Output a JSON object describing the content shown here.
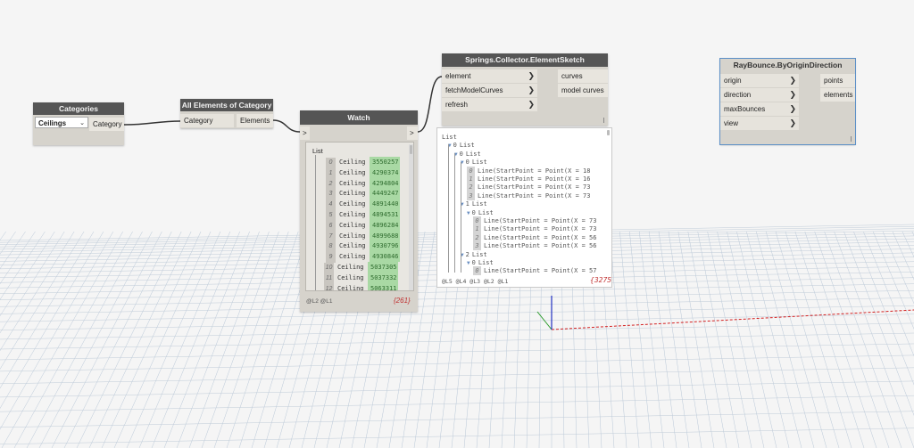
{
  "nodes": {
    "categories": {
      "title": "Categories",
      "dropdown_value": "Ceilings",
      "output": "Category"
    },
    "all_elements": {
      "title": "All Elements of Category",
      "input": "Category",
      "output": "Elements"
    },
    "watch": {
      "title": "Watch",
      "root_label": "List",
      "rows": [
        {
          "idx": "0",
          "cat": "Ceiling",
          "id": "3550257"
        },
        {
          "idx": "1",
          "cat": "Ceiling",
          "id": "4290374"
        },
        {
          "idx": "2",
          "cat": "Ceiling",
          "id": "4294804"
        },
        {
          "idx": "3",
          "cat": "Ceiling",
          "id": "4449247"
        },
        {
          "idx": "4",
          "cat": "Ceiling",
          "id": "4891440"
        },
        {
          "idx": "5",
          "cat": "Ceiling",
          "id": "4894531"
        },
        {
          "idx": "6",
          "cat": "Ceiling",
          "id": "4896284"
        },
        {
          "idx": "7",
          "cat": "Ceiling",
          "id": "4899688"
        },
        {
          "idx": "8",
          "cat": "Ceiling",
          "id": "4930796"
        },
        {
          "idx": "9",
          "cat": "Ceiling",
          "id": "4930846"
        },
        {
          "idx": "10",
          "cat": "Ceiling",
          "id": "5037305"
        },
        {
          "idx": "11",
          "cat": "Ceiling",
          "id": "5037332"
        },
        {
          "idx": "12",
          "cat": "Ceiling",
          "id": "5063311"
        }
      ],
      "levels": "@L2 @L1",
      "count": "{261}"
    },
    "element_sketch": {
      "title": "Springs.Collector.ElementSketch",
      "inputs": [
        "element",
        "fetchModelCurves",
        "refresh"
      ],
      "outputs": [
        "curves",
        "model curves"
      ],
      "preview_rows": [
        {
          "indent": 0,
          "kind": "label",
          "text": "List"
        },
        {
          "indent": 1,
          "kind": "list",
          "idx": "0",
          "text": "List"
        },
        {
          "indent": 2,
          "kind": "list",
          "idx": "0",
          "text": "List"
        },
        {
          "indent": 3,
          "kind": "list",
          "idx": "0",
          "text": "List"
        },
        {
          "indent": 4,
          "kind": "item",
          "idx": "0",
          "text": "Line(StartPoint = Point(X = 18"
        },
        {
          "indent": 4,
          "kind": "item",
          "idx": "1",
          "text": "Line(StartPoint = Point(X = 16"
        },
        {
          "indent": 4,
          "kind": "item",
          "idx": "2",
          "text": "Line(StartPoint = Point(X = 73"
        },
        {
          "indent": 4,
          "kind": "item",
          "idx": "3",
          "text": "Line(StartPoint = Point(X = 73"
        },
        {
          "indent": 3,
          "kind": "list",
          "idx": "1",
          "text": "List"
        },
        {
          "indent": 4,
          "kind": "list",
          "idx": "0",
          "text": "List"
        },
        {
          "indent": 5,
          "kind": "item",
          "idx": "0",
          "text": "Line(StartPoint = Point(X = 73"
        },
        {
          "indent": 5,
          "kind": "item",
          "idx": "1",
          "text": "Line(StartPoint = Point(X = 73"
        },
        {
          "indent": 5,
          "kind": "item",
          "idx": "2",
          "text": "Line(StartPoint = Point(X = 56"
        },
        {
          "indent": 5,
          "kind": "item",
          "idx": "3",
          "text": "Line(StartPoint = Point(X = 56"
        },
        {
          "indent": 3,
          "kind": "list",
          "idx": "2",
          "text": "List"
        },
        {
          "indent": 4,
          "kind": "list",
          "idx": "0",
          "text": "List"
        },
        {
          "indent": 5,
          "kind": "item",
          "idx": "0",
          "text": "Line(StartPoint = Point(X = 57"
        }
      ],
      "levels": "@L5 @L4 @L3 @L2 @L1",
      "count": "{3275}"
    },
    "raybounce": {
      "title": "RayBounce.ByOriginDirection",
      "inputs": [
        "origin",
        "direction",
        "maxBounces",
        "view"
      ],
      "outputs": [
        "points",
        "elements"
      ]
    }
  },
  "colors": {
    "node_header": "#555555",
    "node_body": "#d6d3cc",
    "id_badge": "#a9d9a4",
    "selection": "#5b8fc7",
    "axis_red": "#d32020",
    "axis_green": "#2a9a2a",
    "axis_blue": "#2030c0"
  }
}
